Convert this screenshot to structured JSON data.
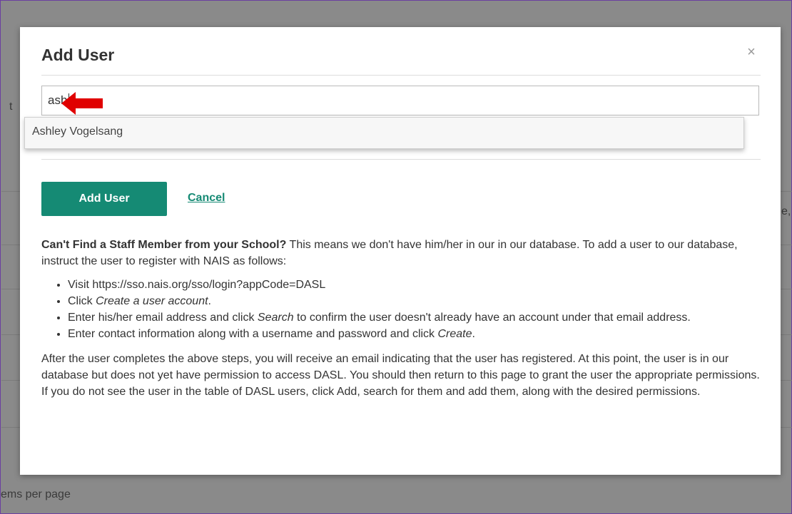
{
  "background": {
    "left_fragment_1": "t",
    "left_fragment_2": "ems per page",
    "right_fragment": "e,"
  },
  "modal": {
    "title": "Add User",
    "close_glyph": "×",
    "search": {
      "value": "ash",
      "placeholder": ""
    },
    "suggestions": [
      {
        "label": "Ashley Vogelsang"
      }
    ],
    "add_button_label": "Add User",
    "cancel_label": "Cancel",
    "help": {
      "heading": "Can't Find a Staff Member from your School?",
      "intro": " This means we don't have him/her in our in our database. To add a user to our database, instruct the user to register with NAIS as follows:",
      "steps": [
        {
          "text": "Visit https://sso.nais.org/sso/login?appCode=DASL",
          "emph": "",
          "after": ""
        },
        {
          "text": "Click ",
          "emph": "Create a user account",
          "after": "."
        },
        {
          "text": "Enter his/her email address and click ",
          "emph": "Search",
          "after": " to confirm the user doesn't already have an account under that email address."
        },
        {
          "text": "Enter contact information along with a username and password and click ",
          "emph": "Create",
          "after": "."
        }
      ],
      "after_steps": "After the user completes the above steps, you will receive an email indicating that the user has registered. At this point, the user is in our database but does not yet have permission to access DASL. You should then return to this page to grant the user the appropriate permissions. If you do not see the user in the table of DASL users, click Add, search for them and add them, along with the desired permissions."
    }
  },
  "annotation": {
    "icon": "red-arrow-left-icon",
    "color": "#e00000"
  },
  "colors": {
    "accent": "#158a74",
    "frame": "#6b3fa0",
    "overlay": "#8a8a8a"
  }
}
